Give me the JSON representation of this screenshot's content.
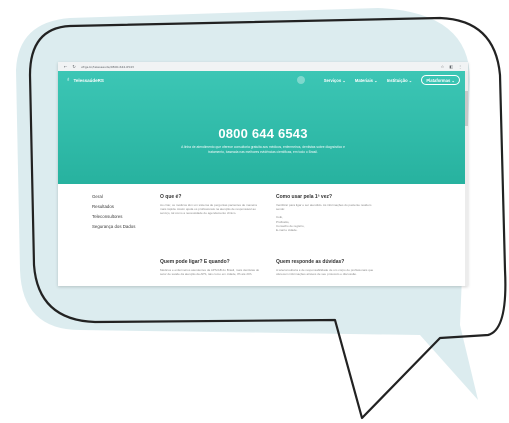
{
  "browser": {
    "url": "ufrgs.br/telessaude/0800-644-6543",
    "nav_icons": [
      "back-arrow-icon",
      "reload-icon"
    ],
    "toolbar_icons": [
      "star-icon",
      "extensions-icon",
      "menu-icon"
    ]
  },
  "brand": {
    "logo_text": "TelessaúdeRS",
    "accent_color": "#2bb8a6"
  },
  "nav": {
    "items": [
      "Serviços",
      "Materiais",
      "Instituição"
    ],
    "cta": "Plataformas"
  },
  "hero": {
    "phone": "0800 644 6543",
    "tagline": "A linha de atendimento que oferece consultoria gratuita aos médicos, enfermeiros, dentistas sobre diagnóstico e tratamento, baseada nas melhores evidências científicas, em todo o Brasil."
  },
  "sidebar": {
    "items": [
      "Geral",
      "Resultados",
      "Teleconsultores",
      "Segurança dos Dados"
    ]
  },
  "sections": [
    {
      "title": "O que é?",
      "text": "Ao criar, os médicos têm um sistema de perguntas pacientes de maneira mais rápida. Assim ajuda os profissionais na atenção de responsável ao serviço, tal como a necessidade de agendamento clínico."
    },
    {
      "title": "Como usar pela 1ª vez?",
      "text": "Ventilizar para ligar e ser atendido. As informações do paciente residem sendo:",
      "list": [
        "CoE,",
        "Profissão,",
        "Conselho de registro,",
        "E-mail e cidade."
      ]
    },
    {
      "title": "Quem pode ligar? E quando?",
      "text": "Médicos e enfermeiros atendentes da APS/AB do Brasil, mais dentistas do setor de saúde da atenção da APS, tais como em cidade, 8h até 20h."
    },
    {
      "title": "Quem responde as dúvidas?",
      "text": "A teleconsultoria é de responsabilidade de um corpo de profissionais que oferecem informações através de seu protocolo e discussão."
    }
  ]
}
